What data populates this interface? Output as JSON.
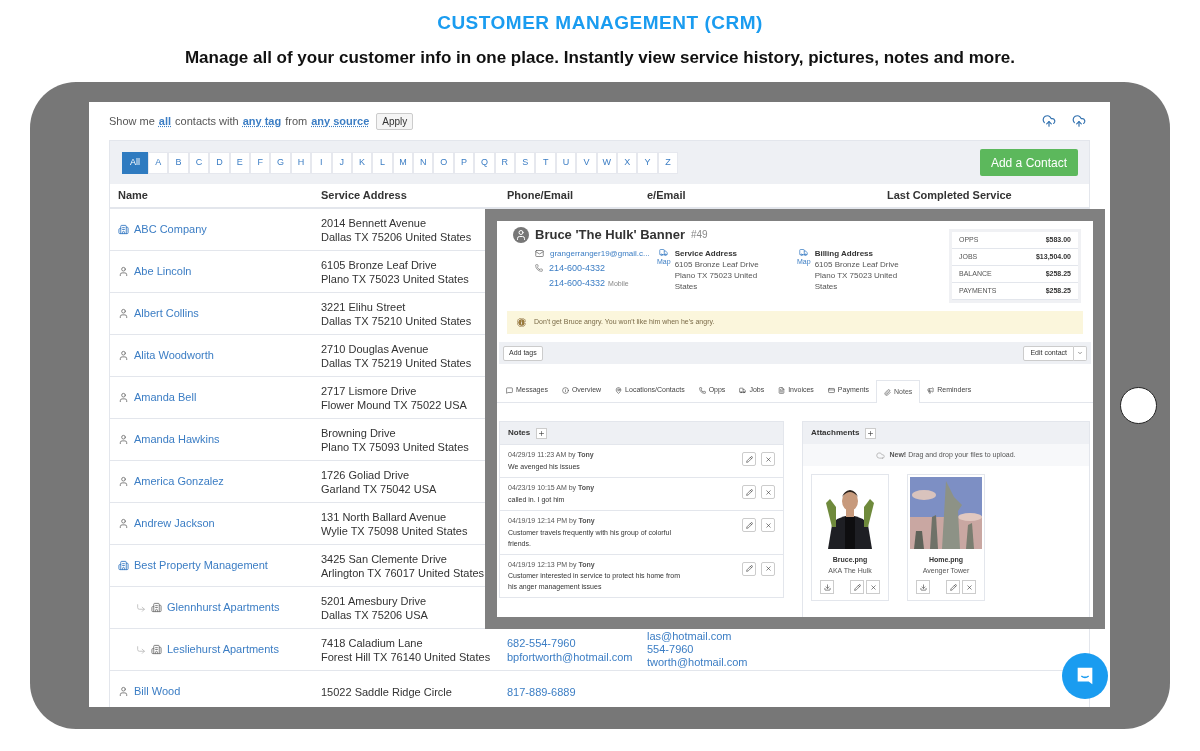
{
  "header": {
    "title": "CUSTOMER MANAGEMENT (CRM)",
    "subtitle": "Manage all of your customer info in one place. Instantly view service history, pictures, notes and more."
  },
  "filter": {
    "parts": [
      {
        "text": "Show me",
        "kind": "plain"
      },
      {
        "text": "all",
        "kind": "link"
      },
      {
        "text": "contacts with",
        "kind": "plain"
      },
      {
        "text": "any tag",
        "kind": "link"
      },
      {
        "text": "from",
        "kind": "plain"
      },
      {
        "text": "any source",
        "kind": "link"
      }
    ],
    "apply": "Apply"
  },
  "letters": [
    {
      "label": "All",
      "selected": true
    },
    {
      "label": "A",
      "selected": false
    },
    {
      "label": "B",
      "selected": false
    },
    {
      "label": "C",
      "selected": false
    },
    {
      "label": "D",
      "selected": false
    },
    {
      "label": "E",
      "selected": false
    },
    {
      "label": "F",
      "selected": false
    },
    {
      "label": "G",
      "selected": false
    },
    {
      "label": "H",
      "selected": false
    },
    {
      "label": "I",
      "selected": false
    },
    {
      "label": "J",
      "selected": false
    },
    {
      "label": "K",
      "selected": false
    },
    {
      "label": "L",
      "selected": false
    },
    {
      "label": "M",
      "selected": false
    },
    {
      "label": "N",
      "selected": false
    },
    {
      "label": "O",
      "selected": false
    },
    {
      "label": "P",
      "selected": false
    },
    {
      "label": "Q",
      "selected": false
    },
    {
      "label": "R",
      "selected": false
    },
    {
      "label": "S",
      "selected": false
    },
    {
      "label": "T",
      "selected": false
    },
    {
      "label": "U",
      "selected": false
    },
    {
      "label": "V",
      "selected": false
    },
    {
      "label": "W",
      "selected": false
    },
    {
      "label": "X",
      "selected": false
    },
    {
      "label": "Y",
      "selected": false
    },
    {
      "label": "Z",
      "selected": false
    }
  ],
  "add_button": "Add a Contact",
  "columns": [
    "Name",
    "Service Address",
    "Phone/Email",
    "e/Email",
    "Last Completed Service"
  ],
  "contacts": [
    {
      "kind": "company",
      "name": "ABC Company",
      "address": [
        "2014 Bennett Avenue",
        "Dallas TX 75206 United States"
      ]
    },
    {
      "kind": "person",
      "name": "Abe Lincoln",
      "address": [
        "6105 Bronze Leaf Drive",
        "Plano TX 75023 United States"
      ]
    },
    {
      "kind": "person",
      "name": "Albert Collins",
      "address": [
        "3221 Elihu Street",
        "Dallas TX 75210 United States"
      ]
    },
    {
      "kind": "person",
      "name": "Alita Woodworth",
      "address": [
        "2710 Douglas Avenue",
        "Dallas TX 75219 United States"
      ]
    },
    {
      "kind": "person",
      "name": "Amanda Bell",
      "address": [
        "2717 Lismore Drive",
        "Flower Mound TX 75022 USA"
      ]
    },
    {
      "kind": "person",
      "name": "Amanda Hawkins",
      "address": [
        "Browning Drive",
        "Plano TX 75093 United States"
      ]
    },
    {
      "kind": "person",
      "name": "America Gonzalez",
      "address": [
        "1726 Goliad Drive",
        "Garland TX 75042 USA"
      ]
    },
    {
      "kind": "person",
      "name": "Andrew Jackson",
      "address": [
        "131 North Ballard Avenue",
        "Wylie TX 75098 United States"
      ]
    },
    {
      "kind": "company",
      "name": "Best Property Management",
      "address": [
        "3425 San Clemente Drive",
        "Arlington TX 76017 United States"
      ],
      "children": [
        {
          "kind": "company",
          "name": "Glennhurst Apartments",
          "address": [
            "5201 Amesbury Drive",
            "Dallas TX 75206 USA"
          ]
        },
        {
          "kind": "company",
          "name": "Lesliehurst Apartments",
          "address": [
            "7418 Caladium Lane",
            "Forest Hill TX 76140 United States"
          ],
          "phone": [
            "682-554-7960",
            "bpfortworth@hotmail.com"
          ],
          "column_4": [
            "las@hotmail.com",
            "554-7960",
            "tworth@hotmail.com"
          ]
        }
      ]
    },
    {
      "kind": "person",
      "name": "Bill Wood",
      "address": [
        "15022 Saddle Ridge Circle"
      ],
      "phone": [
        "817-889-6889"
      ]
    }
  ],
  "contact_card": {
    "name": "Bruce 'The Hulk' Banner",
    "number": "#49",
    "email": "grangerranger19@gmail.c...",
    "phones": [
      {
        "number": "214-600-4332"
      },
      {
        "number": "214-600-4332",
        "label": "Mobile"
      }
    ],
    "addresses": [
      {
        "title": "Service Address",
        "map": "Map",
        "lines": [
          "6105 Bronze Leaf Drive",
          "Plano TX 75023 United",
          "States"
        ]
      },
      {
        "title": "Billing Address",
        "map": "Map",
        "lines": [
          "6105 Bronze Leaf Drive",
          "Plano TX 75023 United",
          "States"
        ]
      }
    ],
    "stats": [
      {
        "label": "OPPS",
        "value": "$583.00"
      },
      {
        "label": "JOBS",
        "value": "$13,504.00"
      },
      {
        "label": "BALANCE",
        "value": "$258.25"
      },
      {
        "label": "PAYMENTS",
        "value": "$258.25"
      }
    ],
    "alert": "Don't get Bruce angry. You won't like him when he's angry.",
    "add_tags": "Add tags",
    "edit_contact": "Edit contact",
    "tabs": [
      {
        "label": "Messages",
        "selected": false
      },
      {
        "label": "Overview",
        "selected": false
      },
      {
        "label": "Locations/Contacts",
        "selected": false
      },
      {
        "label": "Opps",
        "selected": false
      },
      {
        "label": "Jobs",
        "selected": false
      },
      {
        "label": "Invoices",
        "selected": false
      },
      {
        "label": "Payments",
        "selected": false
      },
      {
        "label": "Notes",
        "selected": true
      },
      {
        "label": "Reminders",
        "selected": false
      }
    ],
    "notes": {
      "title": "Notes",
      "items": [
        {
          "meta": "04/29/19 11:23 AM by **Tony**",
          "text": "We avenged his issues"
        },
        {
          "meta": "04/23/19 10:15 AM by **Tony**",
          "text": "called in. I got him"
        },
        {
          "meta": "04/19/19 12:14 PM by **Tony**",
          "text": "Customer travels frequently with his group of colorful friends."
        },
        {
          "meta": "04/19/19 12:13 PM by **Tony**",
          "text": "Customer interested in service to protect his home from his anger management issues"
        }
      ]
    },
    "attachments": {
      "title": "Attachments",
      "drop_hint": "**New!** Drag and drop your files to upload.",
      "files": [
        {
          "kind": "picture",
          "name": "Bruce.png",
          "caption": "AKA The Hulk"
        },
        {
          "kind": "picture",
          "name": "Home.png",
          "caption": "Avenger Tower"
        }
      ]
    }
  }
}
